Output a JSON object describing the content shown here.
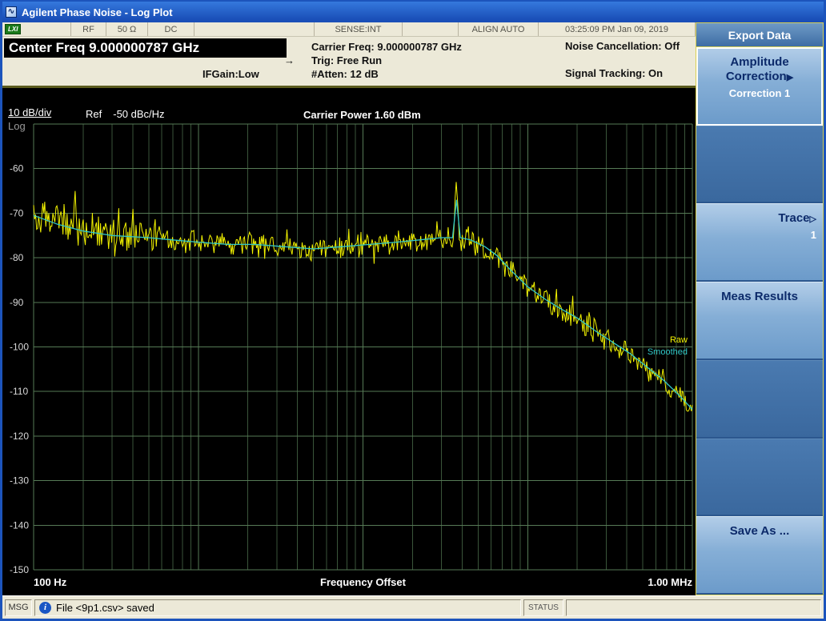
{
  "window": {
    "title": "Agilent Phase Noise - Log Plot"
  },
  "instrument_bar": {
    "lxi": "LXI",
    "rf": "RF",
    "impedance": "50 Ω",
    "coupling": "DC",
    "sense": "SENSE:INT",
    "align": "ALIGN AUTO",
    "datetime": "03:25:09 PM Jan 09, 2019"
  },
  "header": {
    "center_freq": "Center Freq 9.000000787 GHz",
    "ifgain": "IFGain:Low",
    "carrier_freq": "Carrier Freq: 9.000000787 GHz",
    "trig": "Trig: Free Run",
    "atten": "#Atten: 12 dB",
    "noise_cancellation": "Noise Cancellation: Off",
    "signal_tracking": "Signal Tracking: On"
  },
  "plot": {
    "scale": "10 dB/div",
    "scale_type": "Log",
    "ref_label": "Ref",
    "ref_value": "-50 dBc/Hz",
    "carrier_power": "Carrier Power 1.60 dBm"
  },
  "chart_data": {
    "type": "line",
    "title": "Phase noise vs frequency offset",
    "xlabel": "Frequency Offset",
    "x_start_label": "100 Hz",
    "x_end_label": "1.00 MHz",
    "x_scale": "log",
    "x_range_hz": [
      100,
      1000000
    ],
    "y_unit": "dBc/Hz",
    "ylim": [
      -150,
      -50
    ],
    "ref_dbchz": -50,
    "db_per_div": 10,
    "yticks": [
      -60,
      -70,
      -80,
      -90,
      -100,
      -110,
      -120,
      -130,
      -140,
      -150
    ],
    "grid": true,
    "legend_position": "right-inside",
    "series": [
      {
        "name": "Raw",
        "color": "#f2f200",
        "generated_from": "Smoothed",
        "jitter_db": 3
      },
      {
        "name": "Smoothed",
        "color": "#30c8c8",
        "points": [
          [
            100,
            -70.5
          ],
          [
            140,
            -72.5
          ],
          [
            200,
            -74
          ],
          [
            300,
            -75
          ],
          [
            500,
            -75.5
          ],
          [
            700,
            -76
          ],
          [
            1000,
            -76.5
          ],
          [
            1500,
            -77
          ],
          [
            2200,
            -77
          ],
          [
            3300,
            -77.5
          ],
          [
            5000,
            -78
          ],
          [
            7500,
            -77.5
          ],
          [
            11000,
            -77
          ],
          [
            16000,
            -76.5
          ],
          [
            22000,
            -76
          ],
          [
            30000,
            -75.5
          ],
          [
            35000,
            -75.5
          ],
          [
            37000,
            -67
          ],
          [
            39000,
            -75.5
          ],
          [
            45000,
            -76
          ],
          [
            55000,
            -77.5
          ],
          [
            65000,
            -79.5
          ],
          [
            80000,
            -83
          ],
          [
            100000,
            -86.5
          ],
          [
            130000,
            -89.5
          ],
          [
            160000,
            -91.5
          ],
          [
            200000,
            -93.5
          ],
          [
            260000,
            -96.5
          ],
          [
            330000,
            -99
          ],
          [
            420000,
            -101.5
          ],
          [
            530000,
            -104.5
          ],
          [
            670000,
            -107.5
          ],
          [
            840000,
            -111
          ],
          [
            1000000,
            -114
          ]
        ]
      }
    ],
    "spurs": [
      {
        "freq_hz": 180,
        "level_db": -65
      },
      {
        "freq_hz": 37000,
        "level_db": -63
      }
    ]
  },
  "sidebar": {
    "menu_title": "Export Data",
    "keys": [
      {
        "label": "Amplitude Correction",
        "arrow": "filled",
        "value": "Correction 1",
        "active": true
      },
      {
        "label": ""
      },
      {
        "label": "Trace",
        "arrow": "hollow",
        "value": "1",
        "align": "right"
      },
      {
        "label": "Meas Results"
      },
      {
        "label": ""
      },
      {
        "label": ""
      },
      {
        "label": "Save As ..."
      }
    ]
  },
  "statusbar": {
    "msg_label": "MSG",
    "message": "File <9p1.csv> saved",
    "status_label": "STATUS"
  }
}
